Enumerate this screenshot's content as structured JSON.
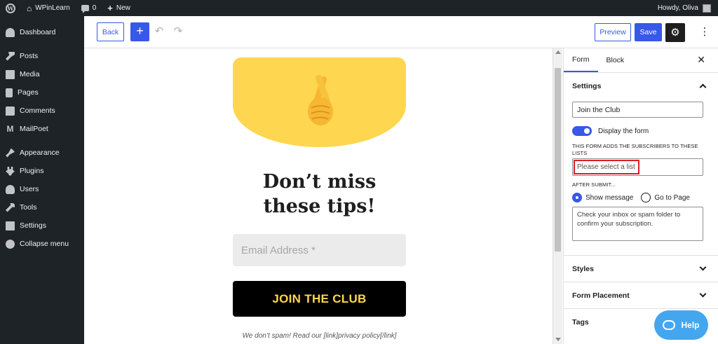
{
  "adminbar": {
    "site_name": "WPinLearn",
    "comment_count": "0",
    "new_label": "New",
    "howdy": "Howdy, Oliva"
  },
  "sidebar": {
    "items": [
      {
        "label": "Dashboard",
        "icon": "dashboard-icon"
      },
      {
        "label": "Posts",
        "icon": "pin-icon"
      },
      {
        "label": "Media",
        "icon": "media-icon"
      },
      {
        "label": "Pages",
        "icon": "pages-icon"
      },
      {
        "label": "Comments",
        "icon": "comments-icon"
      },
      {
        "label": "MailPoet",
        "icon": "mailpoet-icon"
      },
      {
        "label": "Appearance",
        "icon": "brush-icon"
      },
      {
        "label": "Plugins",
        "icon": "plugin-icon"
      },
      {
        "label": "Users",
        "icon": "user-icon"
      },
      {
        "label": "Tools",
        "icon": "wrench-icon"
      },
      {
        "label": "Settings",
        "icon": "settings-icon"
      },
      {
        "label": "Collapse menu",
        "icon": "collapse-icon"
      }
    ]
  },
  "toolbar": {
    "back_label": "Back",
    "add_label": "+",
    "preview_label": "Preview",
    "save_label": "Save"
  },
  "canvas": {
    "heading": "Don’t miss these tips!",
    "email_placeholder": "Email Address *",
    "button_label": "JOIN THE CLUB",
    "note": "We don’t spam! Read our [link]privacy policy[/link]"
  },
  "panel": {
    "tabs": [
      "Form",
      "Block"
    ],
    "settings_title": "Settings",
    "form_name": "Join the Club",
    "display_form_label": "Display the form",
    "lists_label": "THIS FORM ADDS THE SUBSCRIBERS TO THESE LISTS",
    "lists_placeholder": "Please select a list",
    "after_submit_label": "AFTER SUBMIT...",
    "show_message_label": "Show message",
    "go_to_page_label": "Go to Page",
    "message_text": "Check your inbox or spam folder to confirm your subscription.",
    "styles_title": "Styles",
    "placement_title": "Form Placement",
    "tags_title": "Tags"
  },
  "help": {
    "label": "Help"
  },
  "colors": {
    "accent": "#3858e9",
    "admin_bg": "#1d2327",
    "form_yellow": "#ffd64f",
    "highlight": "#e01b24",
    "help_blue": "#45a6f0"
  }
}
